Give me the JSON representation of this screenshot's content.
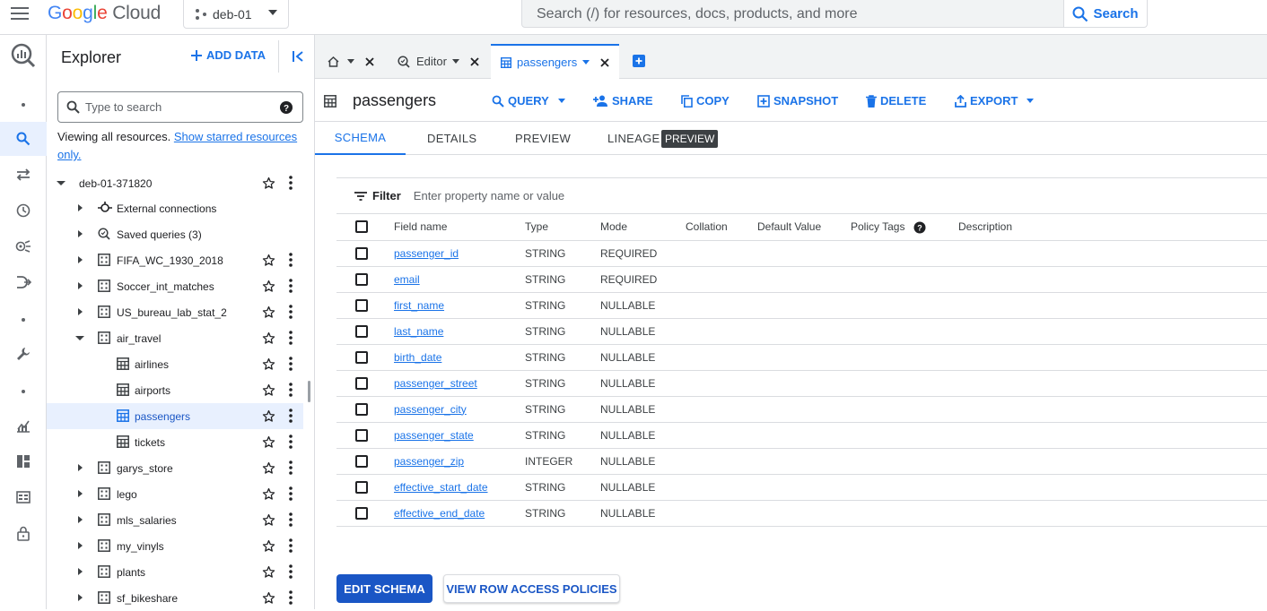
{
  "header": {
    "brand_google": "Google",
    "brand_cloud": "Cloud",
    "project": "deb-01",
    "search_placeholder": "Search (/) for resources, docs, products, and more",
    "search_button": "Search"
  },
  "rail": {
    "icons": [
      "bigquery-logo-icon",
      "dot-icon",
      "search-icon",
      "transfers-icon",
      "scheduled-queries-icon",
      "analytics-hub-icon",
      "dataform-icon",
      "dot-icon",
      "tools-icon",
      "dot-icon",
      "monitoring-icon",
      "dashboard-icon",
      "table-view-icon",
      "lock-icon"
    ]
  },
  "explorer": {
    "title": "Explorer",
    "add_data": "ADD DATA",
    "search_placeholder": "Type to search",
    "viewing_text": "Viewing all resources.",
    "starred_link": "Show starred resources only.",
    "tree": [
      {
        "label": "deb-01-371820",
        "type": "project",
        "level": 0,
        "expanded": true,
        "star": true
      },
      {
        "label": "External connections",
        "type": "connection",
        "level": 1,
        "expanded": false,
        "star": false
      },
      {
        "label": "Saved queries (3)",
        "type": "saved",
        "level": 1,
        "expanded": false,
        "star": false
      },
      {
        "label": "FIFA_WC_1930_2018",
        "type": "dataset",
        "level": 1,
        "expanded": false,
        "star": true
      },
      {
        "label": "Soccer_int_matches",
        "type": "dataset",
        "level": 1,
        "expanded": false,
        "star": true
      },
      {
        "label": "US_bureau_lab_stat_2",
        "type": "dataset",
        "level": 1,
        "expanded": false,
        "star": true
      },
      {
        "label": "air_travel",
        "type": "dataset",
        "level": 1,
        "expanded": true,
        "star": true
      },
      {
        "label": "airlines",
        "type": "table",
        "level": 2,
        "star": true
      },
      {
        "label": "airports",
        "type": "table",
        "level": 2,
        "star": true
      },
      {
        "label": "passengers",
        "type": "table",
        "level": 2,
        "star": true,
        "selected": true
      },
      {
        "label": "tickets",
        "type": "table",
        "level": 2,
        "star": true
      },
      {
        "label": "garys_store",
        "type": "dataset",
        "level": 1,
        "expanded": false,
        "star": true
      },
      {
        "label": "lego",
        "type": "dataset",
        "level": 1,
        "expanded": false,
        "star": true
      },
      {
        "label": "mls_salaries",
        "type": "dataset",
        "level": 1,
        "expanded": false,
        "star": true
      },
      {
        "label": "my_vinyls",
        "type": "dataset",
        "level": 1,
        "expanded": false,
        "star": true
      },
      {
        "label": "plants",
        "type": "dataset",
        "level": 1,
        "expanded": false,
        "star": true
      },
      {
        "label": "sf_bikeshare",
        "type": "dataset",
        "level": 1,
        "expanded": false,
        "star": true
      }
    ]
  },
  "tabs": [
    {
      "label": "",
      "icon": "home-icon"
    },
    {
      "label": "Editor",
      "icon": "query-icon"
    },
    {
      "label": "passengers",
      "icon": "table-icon",
      "active": true
    }
  ],
  "table_header": {
    "name": "passengers",
    "actions": [
      "QUERY",
      "SHARE",
      "COPY",
      "SNAPSHOT",
      "DELETE",
      "EXPORT"
    ]
  },
  "subtabs": [
    "SCHEMA",
    "DETAILS",
    "PREVIEW",
    "LINEAGE"
  ],
  "preview_badge": "PREVIEW",
  "filter": {
    "label": "Filter",
    "placeholder": "Enter property name or value"
  },
  "schema": {
    "columns": [
      "Field name",
      "Type",
      "Mode",
      "Collation",
      "Default Value",
      "Policy Tags",
      "Description"
    ],
    "rows": [
      {
        "name": "passenger_id",
        "type": "STRING",
        "mode": "REQUIRED"
      },
      {
        "name": "email",
        "type": "STRING",
        "mode": "REQUIRED"
      },
      {
        "name": "first_name",
        "type": "STRING",
        "mode": "NULLABLE"
      },
      {
        "name": "last_name",
        "type": "STRING",
        "mode": "NULLABLE"
      },
      {
        "name": "birth_date",
        "type": "STRING",
        "mode": "NULLABLE"
      },
      {
        "name": "passenger_street",
        "type": "STRING",
        "mode": "NULLABLE"
      },
      {
        "name": "passenger_city",
        "type": "STRING",
        "mode": "NULLABLE"
      },
      {
        "name": "passenger_state",
        "type": "STRING",
        "mode": "NULLABLE"
      },
      {
        "name": "passenger_zip",
        "type": "INTEGER",
        "mode": "NULLABLE"
      },
      {
        "name": "effective_start_date",
        "type": "STRING",
        "mode": "NULLABLE"
      },
      {
        "name": "effective_end_date",
        "type": "STRING",
        "mode": "NULLABLE"
      }
    ]
  },
  "buttons": {
    "edit_schema": "EDIT SCHEMA",
    "view_row_access": "VIEW ROW ACCESS POLICIES"
  },
  "colors": {
    "accent": "#1a73e8",
    "primary_button": "#1a56c5",
    "selected_bg": "#e8f0fe",
    "google_blue": "#4285f4",
    "google_red": "#ea4335",
    "google_yellow": "#fbbc04",
    "google_green": "#34a853"
  }
}
